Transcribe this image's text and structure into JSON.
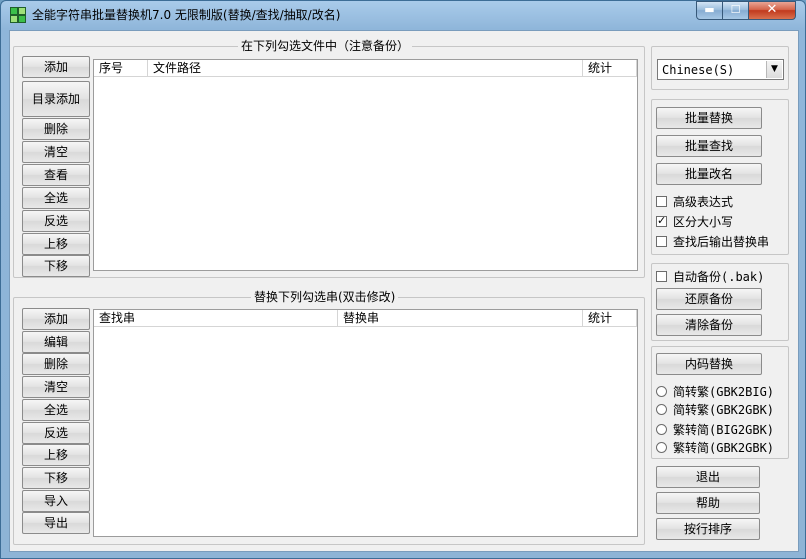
{
  "window": {
    "title": "全能字符串批量替换机7.0 无限制版(替换/查找/抽取/改名)",
    "minimize_glyph": "▬",
    "maximize_glyph": "☐",
    "close_glyph": "✕",
    "app_icon": "green-grid-icon"
  },
  "files_group": {
    "title": "在下列勾选文件中（注意备份）",
    "buttons": [
      "添加",
      "目录添加",
      "删除",
      "清空",
      "查看",
      "全选",
      "反选",
      "上移",
      "下移"
    ],
    "columns": [
      "序号",
      "文件路径",
      "统计"
    ]
  },
  "strings_group": {
    "title": "替换下列勾选串(双击修改)",
    "buttons": [
      "添加",
      "编辑",
      "删除",
      "清空",
      "全选",
      "反选",
      "上移",
      "下移",
      "导入",
      "导出"
    ],
    "columns": [
      "查找串",
      "替换串",
      "统计"
    ]
  },
  "language": {
    "selected": "Chinese(S)"
  },
  "actions": {
    "buttons": [
      "批量替换",
      "批量查找",
      "批量改名"
    ],
    "options": [
      {
        "label": "高级表达式",
        "checked": false
      },
      {
        "label": "区分大小写",
        "checked": true
      },
      {
        "label": "查找后输出替换串",
        "checked": false
      }
    ]
  },
  "backup": {
    "auto_backup_label": "自动备份(.bak)",
    "auto_backup_checked": false,
    "restore_label": "还原备份",
    "clear_label": "清除备份"
  },
  "encoding": {
    "button_label": "内码替换",
    "options": [
      "简转繁(GBK2BIG)",
      "简转繁(GBK2GBK)",
      "繁转简(BIG2GBK)",
      "繁转简(GBK2GBK)"
    ]
  },
  "footer_buttons": [
    "退出",
    "帮助",
    "按行排序"
  ],
  "colors": {
    "title_bar": "#a9cbea",
    "client_bg": "#f0f0f0",
    "close_button": "#c0391d",
    "icon_green": "#2e9e3a"
  }
}
